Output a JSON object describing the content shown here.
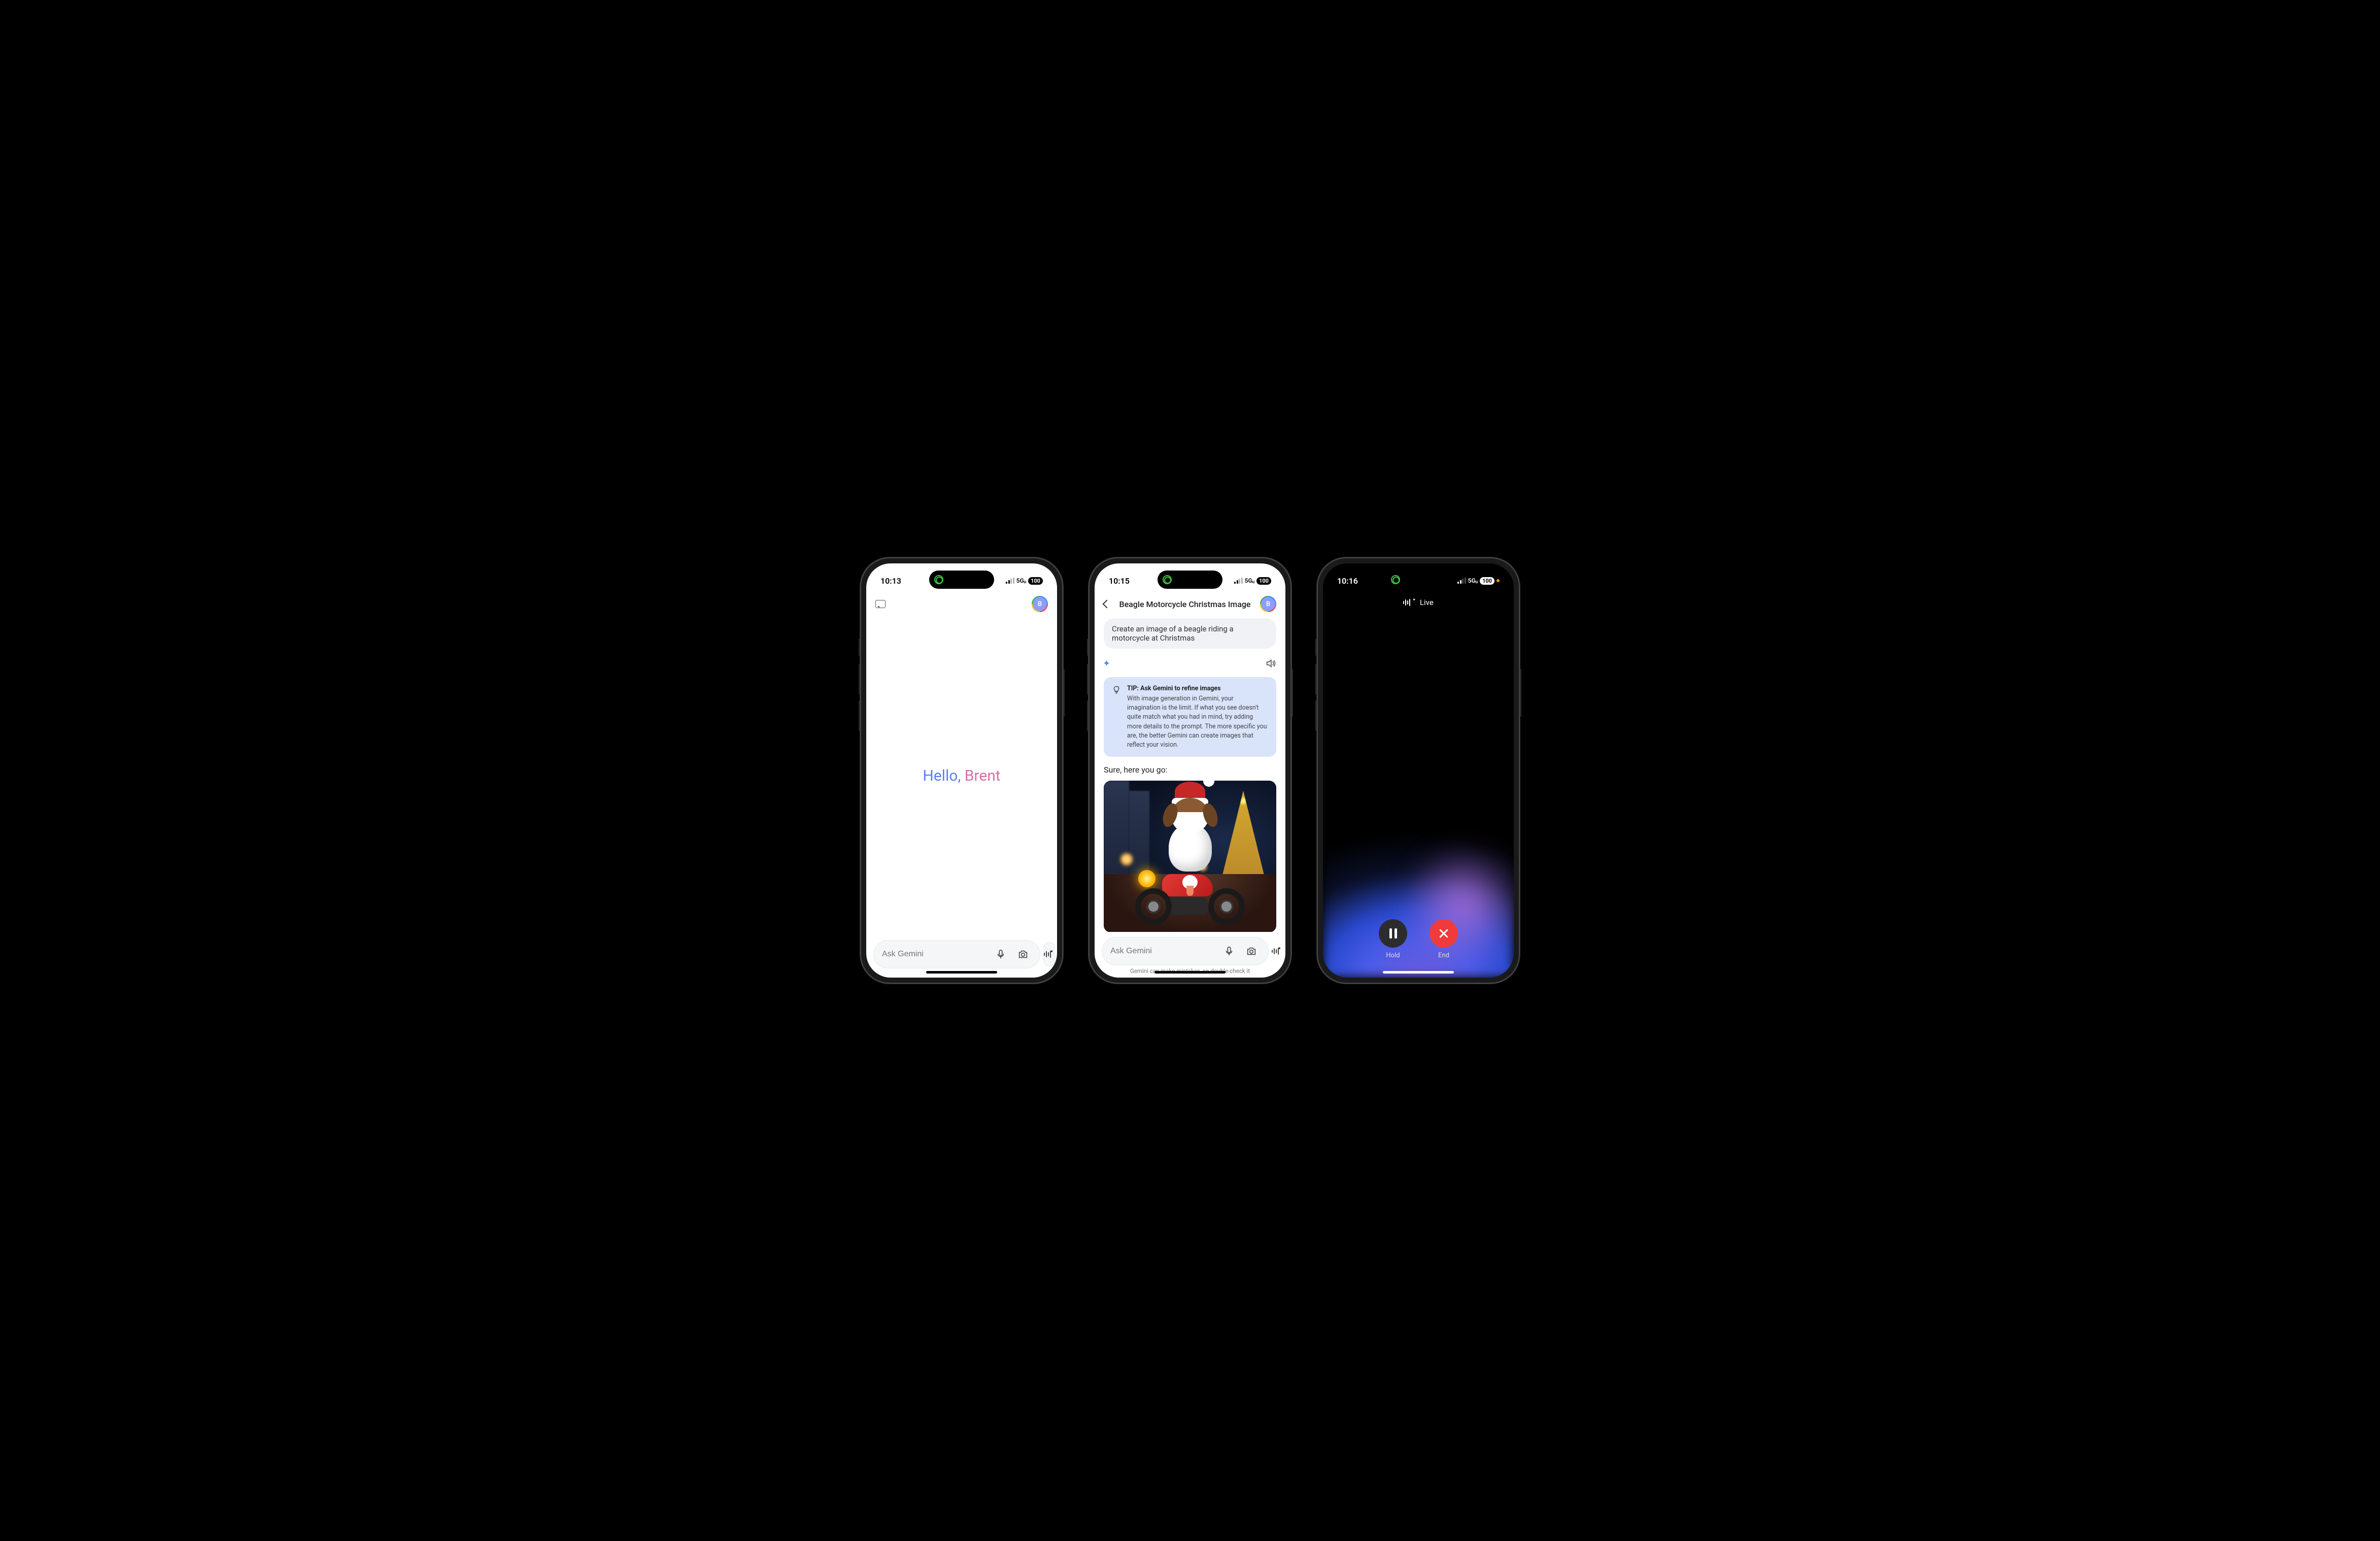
{
  "screen1": {
    "status": {
      "time": "10:13",
      "network": "5Gᵤ",
      "battery": "100"
    },
    "avatar_letter": "B",
    "greeting_hello": "Hello, ",
    "greeting_name": "Brent",
    "input_placeholder": "Ask Gemini"
  },
  "screen2": {
    "status": {
      "time": "10:15",
      "network": "5Gᵤ",
      "battery": "100"
    },
    "title": "Beagle Motorcycle Christmas Image",
    "avatar_letter": "B",
    "user_prompt": "Create an image of a beagle riding a motorcycle at Christmas",
    "tip_title": "TIP: Ask Gemini to refine images",
    "tip_body": "With image generation in Gemini, your imagination is the limit. If what you see doesn't quite match what you had in mind, try adding more details to the prompt. The more specific you are, the better Gemini can create images that reflect your vision.",
    "response_text": "Sure, here you go:",
    "image_alt": "Generated image: beagle in Santa hat on red motorcycle, Christmas tree and city lights",
    "input_placeholder": "Ask Gemini",
    "disclaimer": "Gemini can make mistakes, so double-check it"
  },
  "screen3": {
    "status": {
      "time": "10:16",
      "network": "5Gᵤ",
      "battery": "100"
    },
    "title": "Live",
    "hold_label": "Hold",
    "end_label": "End"
  }
}
